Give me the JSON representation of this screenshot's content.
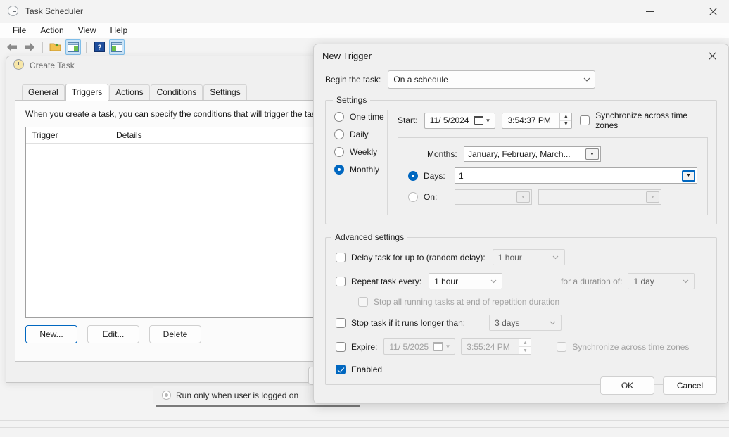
{
  "app": {
    "title": "Task Scheduler",
    "title_icon": "clock-icon",
    "menu": [
      "File",
      "Action",
      "View",
      "Help"
    ],
    "caption_buttons": {
      "minimize": "─",
      "maximize": "☐",
      "close": "✕"
    },
    "toolbar": [
      {
        "name": "back-icon",
        "glyph": "←"
      },
      {
        "name": "forward-icon",
        "glyph": "→"
      },
      {
        "name": "open-folder-icon",
        "glyph": "▤"
      },
      {
        "name": "show-pane-left-icon",
        "glyph": "▥"
      },
      {
        "name": "help-icon",
        "glyph": "?"
      },
      {
        "name": "show-pane-right-icon",
        "glyph": "▦"
      }
    ]
  },
  "create_task": {
    "title": "Create Task",
    "tabs": [
      "General",
      "Triggers",
      "Actions",
      "Conditions",
      "Settings"
    ],
    "active_tab": "Triggers",
    "description": "When you create a task, you can specify the conditions that will trigger the task.",
    "columns": [
      "Trigger",
      "Details"
    ],
    "rows": [],
    "buttons": {
      "new": "New...",
      "edit": "Edit...",
      "delete": "Delete"
    }
  },
  "background": {
    "logon_option": "Run only when user is logged on"
  },
  "new_trigger": {
    "title": "New Trigger",
    "close_glyph": "✕",
    "begin_label": "Begin the task:",
    "begin_value": "On a schedule",
    "settings": {
      "group_title": "Settings",
      "schedule_options": [
        {
          "label": "One time",
          "selected": false
        },
        {
          "label": "Daily",
          "selected": false
        },
        {
          "label": "Weekly",
          "selected": false
        },
        {
          "label": "Monthly",
          "selected": true
        }
      ],
      "start_label": "Start:",
      "start_date": "11/  5/2024",
      "start_time": "3:54:37 PM",
      "sync_timezones_label": "Synchronize across time zones",
      "sync_timezones_checked": false,
      "monthly": {
        "months_label": "Months:",
        "months_value": "January, February, March...",
        "days_label": "Days:",
        "days_value": "1",
        "days_selected": true,
        "on_label": "On:",
        "on_selected": false,
        "on_value_1": "",
        "on_value_2": ""
      }
    },
    "advanced": {
      "group_title": "Advanced settings",
      "delay_label": "Delay task for up to (random delay):",
      "delay_checked": false,
      "delay_value": "1 hour",
      "repeat_label": "Repeat task every:",
      "repeat_checked": false,
      "repeat_value": "1 hour",
      "duration_label": "for a duration of:",
      "duration_value": "1 day",
      "stop_all_label": "Stop all running tasks at end of repetition duration",
      "stop_all_checked": false,
      "stop_longer_label": "Stop task if it runs longer than:",
      "stop_longer_checked": false,
      "stop_longer_value": "3 days",
      "expire_label": "Expire:",
      "expire_checked": false,
      "expire_date": "11/  5/2025",
      "expire_time": "3:55:24 PM",
      "expire_sync_label": "Synchronize across time zones",
      "expire_sync_checked": false,
      "enabled_label": "Enabled",
      "enabled_checked": true
    },
    "footer": {
      "ok": "OK",
      "cancel": "Cancel"
    }
  },
  "colors": {
    "accent": "#0067c0",
    "window_bg": "#f3f3f3",
    "dialog_bg": "#f0f0f0",
    "field_bg": "#ffffff",
    "disabled_text": "#a2a2a2"
  }
}
